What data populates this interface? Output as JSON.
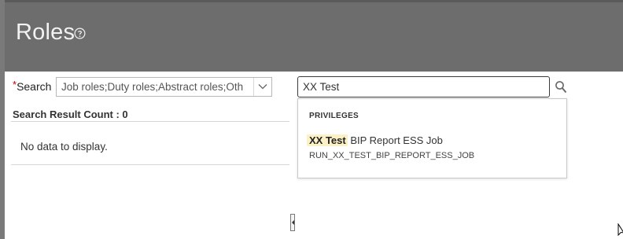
{
  "page": {
    "title": "Roles",
    "help_icon": "help-circle-icon"
  },
  "search": {
    "label": "Search",
    "required_marker": "*",
    "role_type_value": "Job roles;Duty roles;Abstract roles;Oth",
    "keyword_value": "XX Test",
    "search_icon": "search-icon"
  },
  "results": {
    "count_text": "Search Result Count : 0",
    "empty_text": "No data to display."
  },
  "suggestions": {
    "section_header": "PRIVILEGES",
    "items": [
      {
        "match": "XX Test",
        "rest": " BIP Report ESS Job",
        "code": "RUN_XX_TEST_BIP_REPORT_ESS_JOB"
      }
    ]
  },
  "colors": {
    "header_bg": "#6d6d6d",
    "highlight": "#fbf0c6",
    "required": "#bb0000"
  }
}
